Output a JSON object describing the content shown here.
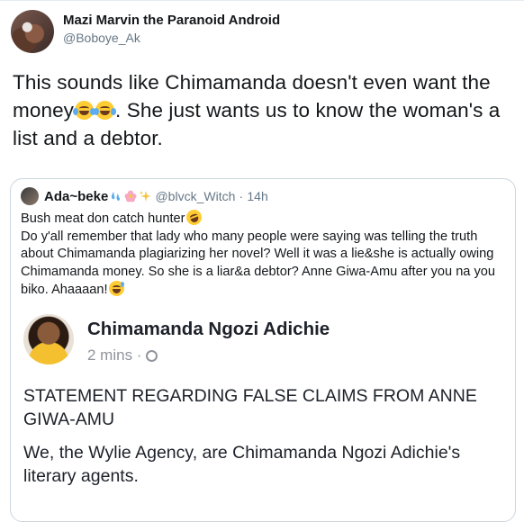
{
  "tweet": {
    "display_name": "Mazi Marvin the Paranoid Android",
    "handle": "@Boboye_Ak",
    "text_part1": "This sounds like Chimamanda doesn't even want the money",
    "text_part2": ". She just wants us to know the woman's a list and a debtor."
  },
  "quoted": {
    "display_name": "Ada~beke",
    "handle": "@blvck_Witch",
    "separator": "·",
    "time": "14h",
    "line1": "Bush meat don catch hunter",
    "body": "Do y'all remember that lady who many people were saying was telling the truth about Chimamanda plagiarizing her novel? Well it was a lie&she is actually owing Chimamanda money. So she is a liar&a debtor? Anne Giwa-Amu after you na you biko. Ahaaaan!"
  },
  "screenshot": {
    "name": "Chimamanda Ngozi Adichie",
    "time": "2 mins ·",
    "statement": "STATEMENT REGARDING FALSE CLAIMS FROM ANNE GIWA-AMU",
    "paragraph": "We, the Wylie Agency, are Chimamanda Ngozi Adichie's literary agents."
  },
  "colors": {
    "text": "#14171a",
    "secondary": "#657786",
    "border": "#ccd6dd",
    "fb_grey": "#90949c"
  },
  "icons": [
    "tears-of-joy-emoji",
    "rofl-emoji",
    "sweat-smile-emoji",
    "sweat-droplets-emoji",
    "blossom-emoji",
    "sparkles-emoji",
    "globe-icon"
  ]
}
